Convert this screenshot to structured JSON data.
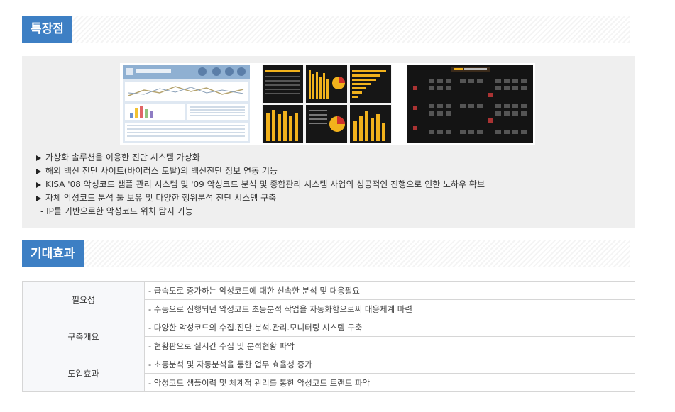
{
  "features_section": {
    "title": "특장점",
    "items": [
      "가상화 솔루션을 이용한 진단 시스템 가상화",
      "해외 백신 진단 사이트(바이러스 토탈)의 백신진단 정보 연동 기능",
      "KISA '08 악성코드 샘플 관리 시스템 및 '09 악성코드 분석 및 종합관리 시스템 사업의 성공적인 진행으로 인한 노하우 확보",
      "자체 악성코드 분석 툴 보유 및 다양한 행위분석 진단 시스템 구축"
    ],
    "sub_item": "- IP를 기반으로한 악성코드 위치 탐지 기능"
  },
  "effects_section": {
    "title": "기대효과",
    "rows": [
      {
        "category": "필요성",
        "details": [
          "- 급속도로 증가하는 악성코드에 대한 신속한 분석 및 대응필요",
          "- 수동으로 진행되던 악성코드 초동분석 작업을 자동화함으로써 대응체계 마련"
        ]
      },
      {
        "category": "구축개요",
        "details": [
          "- 다양한 악성코드의 수집.진단.분석.관리.모니터링 시스템 구축",
          "- 현황판으로 실시간 수집 및 분석현황 파악"
        ]
      },
      {
        "category": "도입효과",
        "details": [
          "- 초동분석 및 자동분석을 통한 업무 효율성 증가",
          "- 악성코드 샘플이력 및 체계적 관리를 통한 악성코드 트랜드 파악"
        ]
      }
    ]
  },
  "colors": {
    "accent": "#3d7fc4",
    "panel_bg": "#efefef",
    "chart_yellow": "#f2b21c",
    "dashboard_dark": "#141414"
  },
  "icons": {
    "bullet": "triangle-right-icon"
  }
}
